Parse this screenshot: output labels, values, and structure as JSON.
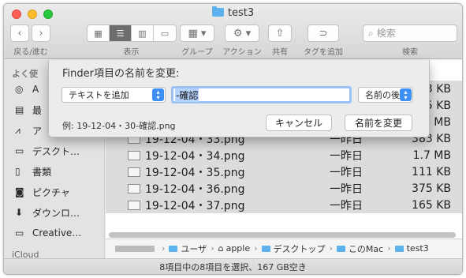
{
  "window": {
    "title": "test3"
  },
  "toolbar": {
    "nav_label": "戻る/進む",
    "view_label": "表示",
    "group_label": "グループ",
    "action_label": "アクション",
    "share_label": "共有",
    "tag_label": "タグを追加",
    "search_label": "検索",
    "search_placeholder": "検索"
  },
  "sidebar": {
    "favorites_header": "よく使",
    "items": [
      {
        "label": "A",
        "icon": "airdrop-icon"
      },
      {
        "label": "最",
        "icon": "recents-icon"
      },
      {
        "label": "ア",
        "icon": "applications-icon"
      },
      {
        "label": "デスクト…",
        "icon": "desktop-icon"
      },
      {
        "label": "書類",
        "icon": "documents-icon"
      },
      {
        "label": "ピクチャ",
        "icon": "pictures-icon"
      },
      {
        "label": "ダウンロ…",
        "icon": "downloads-icon"
      },
      {
        "label": "Creative…",
        "icon": "folder-icon"
      }
    ],
    "icloud_header": "iCloud"
  },
  "files": [
    {
      "name": "",
      "date": "",
      "size": "3 KB"
    },
    {
      "name": "",
      "date": "",
      "size": "5 KB"
    },
    {
      "name": "",
      "date": "",
      "size": "3 MB"
    },
    {
      "name": "19-12-04・33.png",
      "date": "一昨日",
      "size": "383 KB"
    },
    {
      "name": "19-12-04・34.png",
      "date": "一昨日",
      "size": "1.7 MB"
    },
    {
      "name": "19-12-04・35.png",
      "date": "一昨日",
      "size": "111 KB"
    },
    {
      "name": "19-12-04・36.png",
      "date": "一昨日",
      "size": "375 KB"
    },
    {
      "name": "19-12-04・37.png",
      "date": "一昨日",
      "size": "165 KB"
    }
  ],
  "pathbar": {
    "segments": [
      "ユーザ",
      "apple",
      "デスクトップ",
      "このMac",
      "test3"
    ]
  },
  "status": {
    "text": "8項目中の8項目を選択、167 GB空き"
  },
  "dialog": {
    "title": "Finder項目の名前を変更:",
    "mode": "テキストを追加",
    "input_value": "-確認",
    "position": "名前の後",
    "example": "例: 19-12-04・30-確認.png",
    "cancel": "キャンセル",
    "rename": "名前を変更"
  },
  "colors": {
    "accent": "#3d8ff5",
    "selection": "#dcdcdc",
    "folder": "#5bb2ee"
  }
}
